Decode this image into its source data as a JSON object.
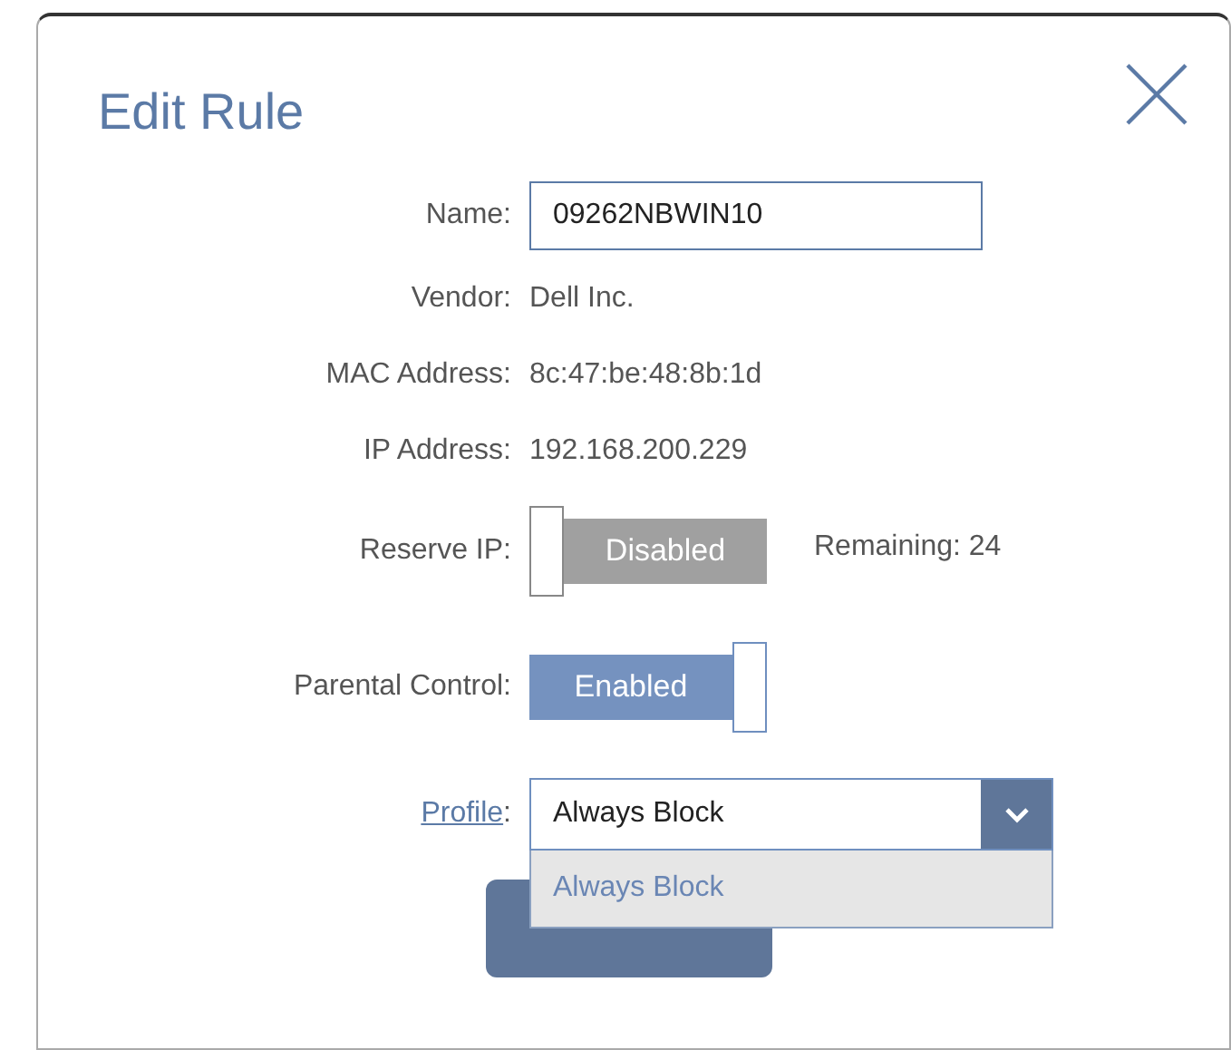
{
  "dialog": {
    "title": "Edit Rule"
  },
  "fields": [
    {
      "kind": "input",
      "label": "Name:",
      "value": "09262NBWIN10"
    },
    {
      "kind": "text",
      "label": "Vendor:",
      "value": "Dell Inc."
    },
    {
      "kind": "text",
      "label": "MAC Address:",
      "value": "8c:47:be:48:8b:1d"
    },
    {
      "kind": "text",
      "label": "IP Address:",
      "value": "192.168.200.229"
    },
    {
      "kind": "toggle",
      "label": "Reserve IP:",
      "on": false,
      "state_text": "Disabled",
      "note": "Remaining: 24"
    },
    {
      "kind": "toggle",
      "label": "Parental Control:",
      "on": true,
      "state_text": "Enabled"
    },
    {
      "kind": "select",
      "label_link": "Profile",
      "label_suffix": ":",
      "value": "Always Block",
      "expanded": true,
      "options": [
        {
          "label": "Always Block",
          "selected": true
        }
      ]
    }
  ],
  "buttons": [
    {
      "kind": "primary"
    }
  ]
}
